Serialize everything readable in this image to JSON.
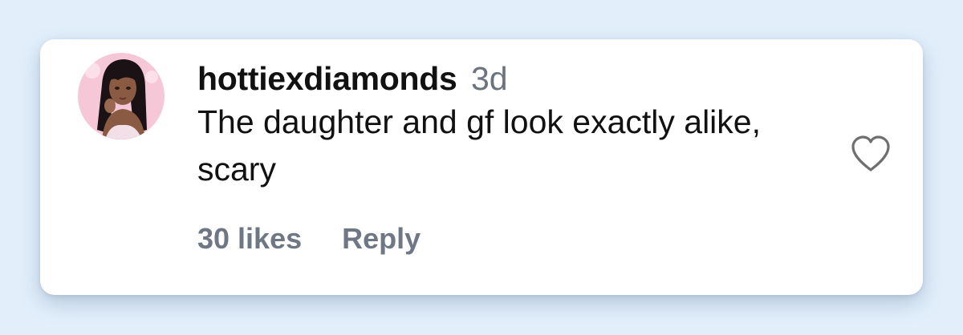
{
  "comment": {
    "username": "hottiexdiamonds",
    "timestamp": "3d",
    "text": "The daughter and gf look exactly alike, scary",
    "likes_label": "30 likes",
    "reply_label": "Reply",
    "avatar_icon": "user-avatar",
    "like_icon": "heart-outline-icon"
  },
  "colors": {
    "background": "#e2effb",
    "card": "#ffffff",
    "text": "#111111",
    "muted": "#6b7280",
    "avatar_bg": "#f6c7d6"
  }
}
